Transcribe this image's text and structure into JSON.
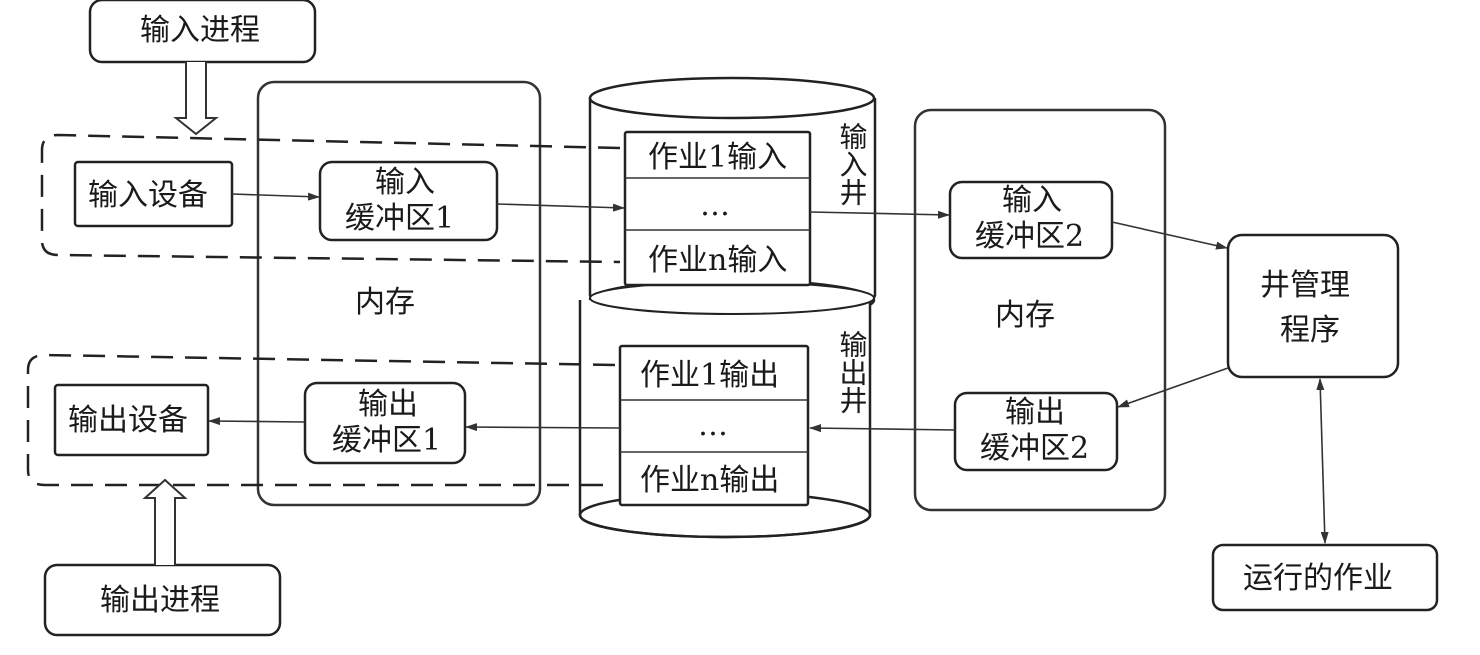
{
  "nodes": {
    "input_process": "输入进程",
    "output_process": "输出进程",
    "input_device": "输入设备",
    "output_device": "输出设备",
    "input_buffer_1": [
      "输入",
      "缓冲区1"
    ],
    "output_buffer_1": [
      "输出",
      "缓冲区1"
    ],
    "input_buffer_2": [
      "输入",
      "缓冲区2"
    ],
    "output_buffer_2": [
      "输出",
      "缓冲区2"
    ],
    "memory_left": "内存",
    "memory_right": "内存",
    "well_manager": [
      "井管理",
      "程序"
    ],
    "running_job": "运行的作业"
  },
  "input_well": {
    "label": "输入井",
    "rows": [
      "作业1输入",
      "…",
      "作业n输入"
    ]
  },
  "output_well": {
    "label": "输出井",
    "rows": [
      "作业1输出",
      "…",
      "作业n输出"
    ]
  }
}
